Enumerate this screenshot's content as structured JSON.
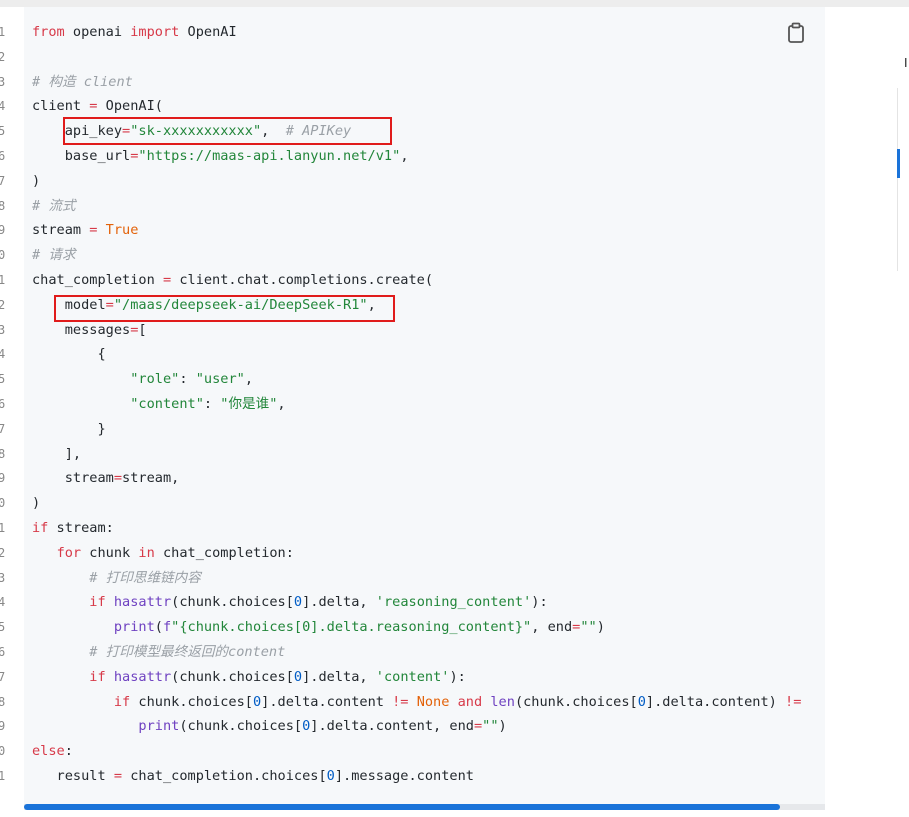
{
  "code_block": {
    "line_numbers": [
      "1",
      "2",
      "3",
      "4",
      "5",
      "6",
      "7",
      "8",
      "9",
      "0",
      "1",
      "2",
      "3",
      "4",
      "5",
      "6",
      "7",
      "8",
      "9",
      "0",
      "1",
      "2",
      "3",
      "4",
      "5",
      "6",
      "7",
      "8",
      "9",
      "0",
      "1"
    ],
    "lines": [
      "from openai import OpenAI",
      "",
      "# 构造 client",
      "client = OpenAI(",
      "    api_key=\"sk-xxxxxxxxxxx\",  # APIKey",
      "    base_url=\"https://maas-api.lanyun.net/v1\",",
      ")",
      "# 流式",
      "stream = True",
      "# 请求",
      "chat_completion = client.chat.completions.create(",
      "    model=\"/maas/deepseek-ai/DeepSeek-R1\",",
      "    messages=[",
      "        {",
      "            \"role\": \"user\",",
      "            \"content\": \"你是谁\",",
      "        }",
      "    ],",
      "    stream=stream,",
      ")",
      "if stream:",
      "   for chunk in chat_completion:",
      "       # 打印思维链内容",
      "       if hasattr(chunk.choices[0].delta, 'reasoning_content'):",
      "          print(f\"{chunk.choices[0].delta.reasoning_content}\", end=\"\")",
      "       # 打印模型最终返回的content",
      "       if hasattr(chunk.choices[0].delta, 'content'):",
      "          if chunk.choices[0].delta.content != None and len(chunk.choices[0].delta.content) !=",
      "             print(chunk.choices[0].delta.content, end=\"\")",
      "else:",
      "   result = chat_completion.choices[0].message.content"
    ],
    "copy_icon": "clipboard-icon"
  },
  "sidebar": {
    "glyph": "I"
  },
  "colors": {
    "highlight_box": "#e01b1b",
    "keyword": "#d73a49",
    "string": "#22863a",
    "comment": "#9aa0a6",
    "function": "#6f42c1",
    "constant": "#e36209",
    "number": "#005cc5",
    "scroll_thumb": "#1a73d9",
    "panel_bg": "#f6f8fa"
  }
}
